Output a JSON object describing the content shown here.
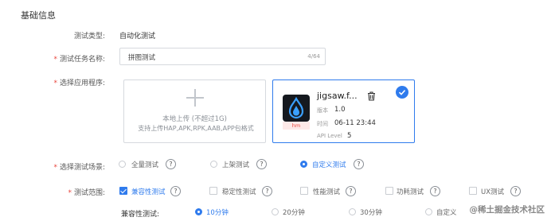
{
  "section_title": "基础信息",
  "test_type": {
    "label": "测试类型:",
    "value": "自动化测试"
  },
  "task_name": {
    "label": "测试任务名称:",
    "value": "拼图测试",
    "counter": "4/64"
  },
  "app_select": {
    "label": "选择应用程序:",
    "upload_line1": "本地上传 (不超过1G)",
    "upload_line2": "支持上传HAP,APK,RPK,AAB,APP包格式",
    "card": {
      "name": "jigsaw.f...",
      "badge": "hm",
      "version_label": "版本",
      "version": "1.0",
      "time_label": "时间",
      "time": "06-11 23:44",
      "api_label": "API Level",
      "api": "5"
    }
  },
  "scene": {
    "label": "选择测试场景:",
    "options": [
      "全量测试",
      "上架测试",
      "自定义测试"
    ],
    "selected": 2
  },
  "scope": {
    "label": "测试范围:",
    "options": [
      "兼容性测试",
      "稳定性测试",
      "性能测试",
      "功耗测试",
      "UX测试"
    ],
    "checked": [
      0
    ]
  },
  "compat": {
    "label": "兼容性测试:",
    "options": [
      "10分钟",
      "20分钟",
      "30分钟",
      "自定义"
    ],
    "selected": 0
  },
  "help_glyph": "?",
  "watermark": "@稀土掘金技术社区",
  "colors": {
    "accent": "#2f7bed",
    "required": "#e8453c"
  }
}
